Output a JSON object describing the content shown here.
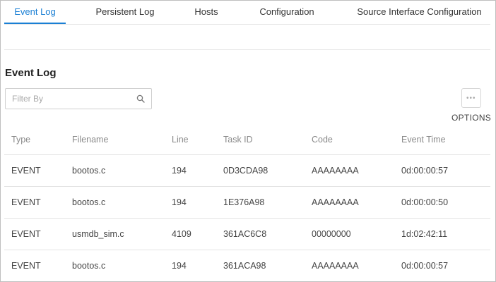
{
  "tabs": [
    {
      "label": "Event Log",
      "active": true
    },
    {
      "label": "Persistent Log",
      "active": false
    },
    {
      "label": "Hosts",
      "active": false
    },
    {
      "label": "Configuration",
      "active": false
    },
    {
      "label": "Source Interface Configuration",
      "active": false
    }
  ],
  "section_title": "Event Log",
  "filter": {
    "placeholder": "Filter By",
    "value": ""
  },
  "options": {
    "label": "OPTIONS",
    "icon": "more-dots-icon"
  },
  "colors": {
    "accent": "#1a7fd4"
  },
  "table": {
    "columns": [
      "Type",
      "Filename",
      "Line",
      "Task ID",
      "Code",
      "Event Time"
    ],
    "rows": [
      [
        "EVENT",
        "bootos.c",
        "194",
        "0D3CDA98",
        "AAAAAAAA",
        "0d:00:00:57"
      ],
      [
        "EVENT",
        "bootos.c",
        "194",
        "1E376A98",
        "AAAAAAAA",
        "0d:00:00:50"
      ],
      [
        "EVENT",
        "usmdb_sim.c",
        "4109",
        "361AC6C8",
        "00000000",
        "1d:02:42:11"
      ],
      [
        "EVENT",
        "bootos.c",
        "194",
        "361ACA98",
        "AAAAAAAA",
        "0d:00:00:57"
      ]
    ]
  }
}
